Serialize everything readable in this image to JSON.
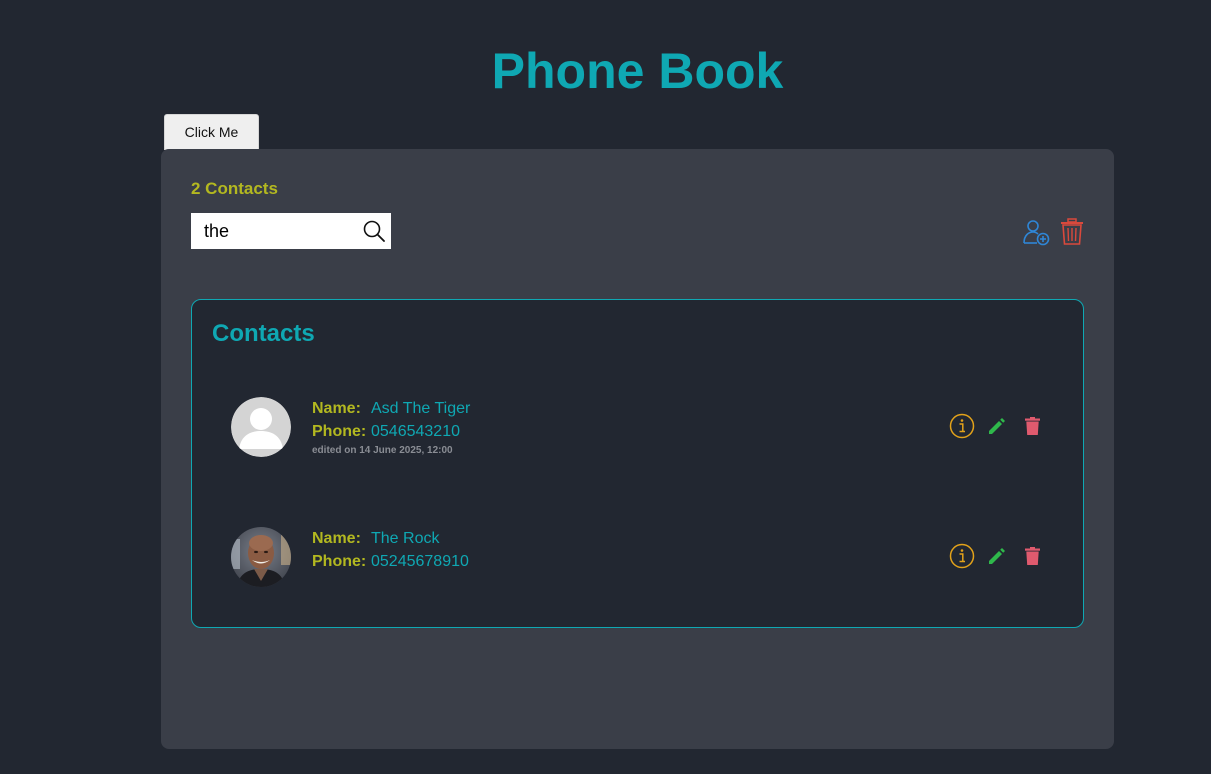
{
  "title": "Phone Book",
  "click_button": "Click Me",
  "contacts_count": "2 Contacts",
  "search": {
    "value": "the",
    "icon": "search-icon"
  },
  "toolbar": {
    "add_icon": "add-contact-icon",
    "delete_all_icon": "trash-icon"
  },
  "list": {
    "heading": "Contacts",
    "name_label": "Name:",
    "phone_label": "Phone:",
    "items": [
      {
        "name": "Asd The Tiger",
        "phone": "0546543210",
        "edited": "edited on 14 June 2025, 12:00",
        "avatar": "default-avatar"
      },
      {
        "name": "The Rock",
        "phone": "05245678910",
        "edited": "",
        "avatar": "photo-avatar"
      }
    ]
  },
  "colors": {
    "background": "#222731",
    "panel": "#3a3e48",
    "accent": "#0fa8b3",
    "label": "#b3b820",
    "info": "#e3a21a",
    "edit": "#2fb84b",
    "delete": "#e05a6e",
    "add": "#2f86d6"
  }
}
